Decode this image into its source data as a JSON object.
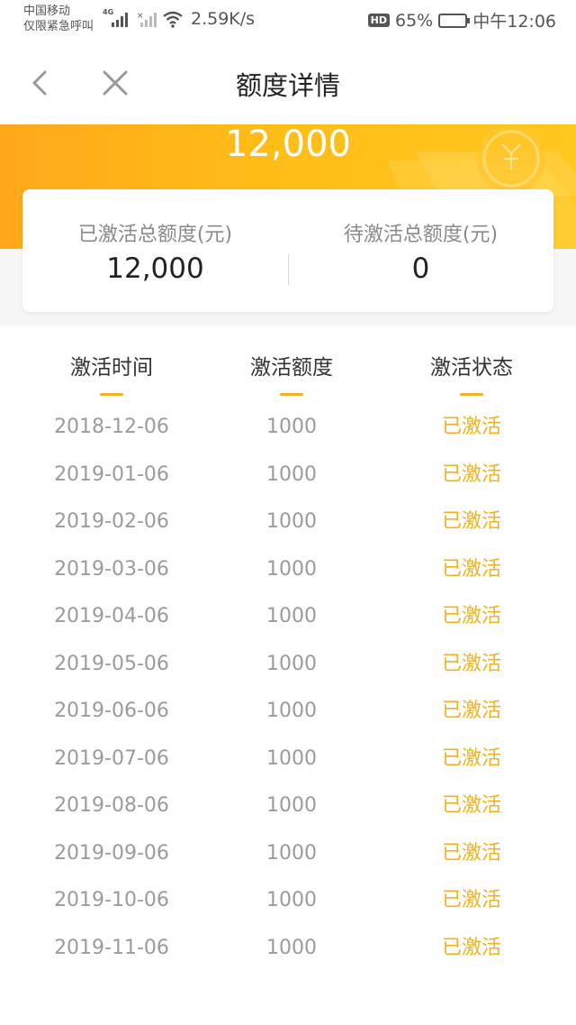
{
  "status_bar": {
    "carrier_line1": "中国移动",
    "carrier_line2": "仅限紧急呼叫",
    "network": "4G",
    "speed": "2.59K/s",
    "hd": "HD",
    "battery": "65%",
    "battery_level": 0.65,
    "time": "中午12:06"
  },
  "nav": {
    "title": "额度详情",
    "back_icon": "chevron-left-icon",
    "close_icon": "close-icon"
  },
  "banner": {
    "amount": "12,000"
  },
  "summary": {
    "activated_label": "已激活总额度(元)",
    "activated_value": "12,000",
    "pending_label": "待激活总额度(元)",
    "pending_value": "0"
  },
  "table": {
    "headers": [
      "激活时间",
      "激活额度",
      "激活状态"
    ],
    "rows": [
      {
        "date": "2018-12-06",
        "amount": "1000",
        "status": "已激活"
      },
      {
        "date": "2019-01-06",
        "amount": "1000",
        "status": "已激活"
      },
      {
        "date": "2019-02-06",
        "amount": "1000",
        "status": "已激活"
      },
      {
        "date": "2019-03-06",
        "amount": "1000",
        "status": "已激活"
      },
      {
        "date": "2019-04-06",
        "amount": "1000",
        "status": "已激活"
      },
      {
        "date": "2019-05-06",
        "amount": "1000",
        "status": "已激活"
      },
      {
        "date": "2019-06-06",
        "amount": "1000",
        "status": "已激活"
      },
      {
        "date": "2019-07-06",
        "amount": "1000",
        "status": "已激活"
      },
      {
        "date": "2019-08-06",
        "amount": "1000",
        "status": "已激活"
      },
      {
        "date": "2019-09-06",
        "amount": "1000",
        "status": "已激活"
      },
      {
        "date": "2019-10-06",
        "amount": "1000",
        "status": "已激活"
      },
      {
        "date": "2019-11-06",
        "amount": "1000",
        "status": "已激活"
      }
    ]
  },
  "colors": {
    "accent": "#f0b21e",
    "banner_start": "#ffa81a",
    "banner_end": "#ffc81e"
  }
}
